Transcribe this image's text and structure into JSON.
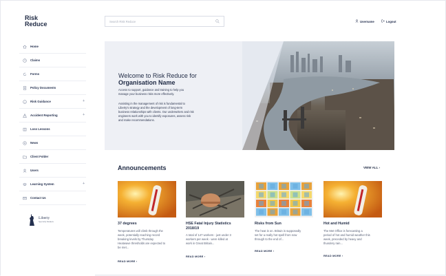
{
  "brand": {
    "line1": "Risk",
    "line2": "Reduce"
  },
  "search": {
    "placeholder": "Search Risk Reduce"
  },
  "header": {
    "username": "Username",
    "logout": "Logout"
  },
  "nav": [
    {
      "label": "Home",
      "icon": "home-icon"
    },
    {
      "label": "Claims",
      "icon": "clock-icon"
    },
    {
      "label": "Forms",
      "icon": "refresh-icon"
    },
    {
      "label": "Policy Documents",
      "icon": "document-icon"
    },
    {
      "label": "Risk Guidance",
      "icon": "info-icon",
      "expand": "+"
    },
    {
      "label": "Accident Reporting",
      "icon": "alert-icon",
      "expand": "+"
    },
    {
      "label": "Loss Lessons",
      "icon": "book-icon"
    },
    {
      "label": "News",
      "icon": "news-icon"
    },
    {
      "label": "Client Folder",
      "icon": "folder-icon"
    },
    {
      "label": "Users",
      "icon": "users-icon"
    },
    {
      "label": "Learning System",
      "icon": "graduation-icon",
      "expand": "+"
    },
    {
      "label": "Contact Us",
      "icon": "mail-icon"
    }
  ],
  "partner": {
    "name": "Liberty",
    "sub": "Specialty Markets"
  },
  "hero": {
    "title_line1": "Welcome to Risk Reduce for",
    "title_line2": "Organisation Name",
    "para1_l1": "Access to support, guidance and training to help you",
    "para1_l2": "manage your business risks more effectively.",
    "para2_l1": "Assisting in the management of risk is fundamental to",
    "para2_l2": "Liberty's strategy and the development of long-term",
    "para2_l3": "business relationships with clients. Our underwriters and risk",
    "para2_l4": "engineers work with you to identify exposures, assess risk",
    "para2_l5": "and make recommendations."
  },
  "announcements": {
    "title": "Announcements",
    "view_all": "VIEW ALL ›",
    "read_more": "READ MORE ›",
    "items": [
      {
        "title": "37 degrees",
        "title_l2": "",
        "body": [
          "Temperatures will climb through the",
          "week, potentially reaching record",
          "breaking levels by Thursday",
          "Heatwave thresholds are expected to",
          "be met..."
        ]
      },
      {
        "title": "HSE Fatal Injury Statistics",
        "title_l2": "2018/19",
        "body": [
          "A total of 147 workers - just under 3",
          "workers per week - were killed at",
          "work in Great Britain..."
        ]
      },
      {
        "title": "Risks from Sun",
        "title_l2": "",
        "body": [
          "The heat is on. Britain is supposedly",
          "set for a really hot spell from now",
          "through to the end of..."
        ]
      },
      {
        "title": "Hot and Humid",
        "title_l2": "",
        "body": [
          "The Met Office is forecasting a",
          "period of hot and humid weather this",
          "week, preceded by heavy and",
          "thundery rain..."
        ]
      }
    ]
  }
}
